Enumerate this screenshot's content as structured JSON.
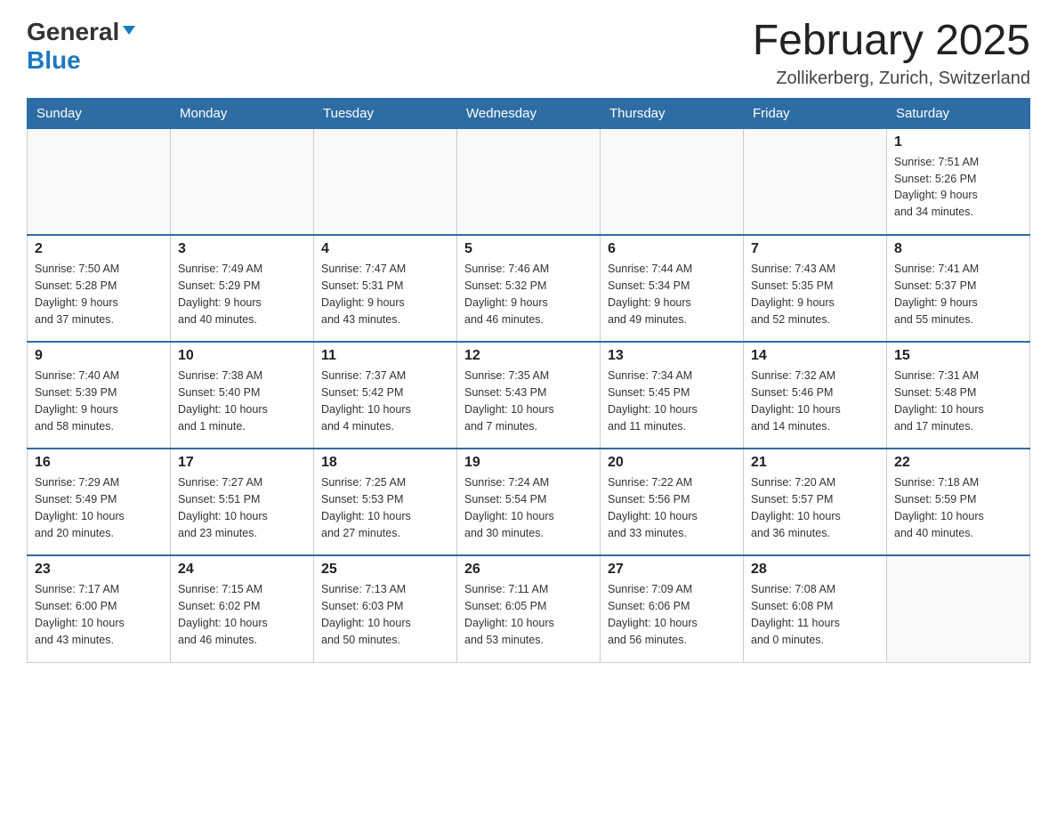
{
  "header": {
    "logo_general": "General",
    "logo_blue": "Blue",
    "month_title": "February 2025",
    "location": "Zollikerberg, Zurich, Switzerland"
  },
  "weekdays": [
    "Sunday",
    "Monday",
    "Tuesday",
    "Wednesday",
    "Thursday",
    "Friday",
    "Saturday"
  ],
  "weeks": [
    [
      {
        "day": "",
        "info": ""
      },
      {
        "day": "",
        "info": ""
      },
      {
        "day": "",
        "info": ""
      },
      {
        "day": "",
        "info": ""
      },
      {
        "day": "",
        "info": ""
      },
      {
        "day": "",
        "info": ""
      },
      {
        "day": "1",
        "info": "Sunrise: 7:51 AM\nSunset: 5:26 PM\nDaylight: 9 hours\nand 34 minutes."
      }
    ],
    [
      {
        "day": "2",
        "info": "Sunrise: 7:50 AM\nSunset: 5:28 PM\nDaylight: 9 hours\nand 37 minutes."
      },
      {
        "day": "3",
        "info": "Sunrise: 7:49 AM\nSunset: 5:29 PM\nDaylight: 9 hours\nand 40 minutes."
      },
      {
        "day": "4",
        "info": "Sunrise: 7:47 AM\nSunset: 5:31 PM\nDaylight: 9 hours\nand 43 minutes."
      },
      {
        "day": "5",
        "info": "Sunrise: 7:46 AM\nSunset: 5:32 PM\nDaylight: 9 hours\nand 46 minutes."
      },
      {
        "day": "6",
        "info": "Sunrise: 7:44 AM\nSunset: 5:34 PM\nDaylight: 9 hours\nand 49 minutes."
      },
      {
        "day": "7",
        "info": "Sunrise: 7:43 AM\nSunset: 5:35 PM\nDaylight: 9 hours\nand 52 minutes."
      },
      {
        "day": "8",
        "info": "Sunrise: 7:41 AM\nSunset: 5:37 PM\nDaylight: 9 hours\nand 55 minutes."
      }
    ],
    [
      {
        "day": "9",
        "info": "Sunrise: 7:40 AM\nSunset: 5:39 PM\nDaylight: 9 hours\nand 58 minutes."
      },
      {
        "day": "10",
        "info": "Sunrise: 7:38 AM\nSunset: 5:40 PM\nDaylight: 10 hours\nand 1 minute."
      },
      {
        "day": "11",
        "info": "Sunrise: 7:37 AM\nSunset: 5:42 PM\nDaylight: 10 hours\nand 4 minutes."
      },
      {
        "day": "12",
        "info": "Sunrise: 7:35 AM\nSunset: 5:43 PM\nDaylight: 10 hours\nand 7 minutes."
      },
      {
        "day": "13",
        "info": "Sunrise: 7:34 AM\nSunset: 5:45 PM\nDaylight: 10 hours\nand 11 minutes."
      },
      {
        "day": "14",
        "info": "Sunrise: 7:32 AM\nSunset: 5:46 PM\nDaylight: 10 hours\nand 14 minutes."
      },
      {
        "day": "15",
        "info": "Sunrise: 7:31 AM\nSunset: 5:48 PM\nDaylight: 10 hours\nand 17 minutes."
      }
    ],
    [
      {
        "day": "16",
        "info": "Sunrise: 7:29 AM\nSunset: 5:49 PM\nDaylight: 10 hours\nand 20 minutes."
      },
      {
        "day": "17",
        "info": "Sunrise: 7:27 AM\nSunset: 5:51 PM\nDaylight: 10 hours\nand 23 minutes."
      },
      {
        "day": "18",
        "info": "Sunrise: 7:25 AM\nSunset: 5:53 PM\nDaylight: 10 hours\nand 27 minutes."
      },
      {
        "day": "19",
        "info": "Sunrise: 7:24 AM\nSunset: 5:54 PM\nDaylight: 10 hours\nand 30 minutes."
      },
      {
        "day": "20",
        "info": "Sunrise: 7:22 AM\nSunset: 5:56 PM\nDaylight: 10 hours\nand 33 minutes."
      },
      {
        "day": "21",
        "info": "Sunrise: 7:20 AM\nSunset: 5:57 PM\nDaylight: 10 hours\nand 36 minutes."
      },
      {
        "day": "22",
        "info": "Sunrise: 7:18 AM\nSunset: 5:59 PM\nDaylight: 10 hours\nand 40 minutes."
      }
    ],
    [
      {
        "day": "23",
        "info": "Sunrise: 7:17 AM\nSunset: 6:00 PM\nDaylight: 10 hours\nand 43 minutes."
      },
      {
        "day": "24",
        "info": "Sunrise: 7:15 AM\nSunset: 6:02 PM\nDaylight: 10 hours\nand 46 minutes."
      },
      {
        "day": "25",
        "info": "Sunrise: 7:13 AM\nSunset: 6:03 PM\nDaylight: 10 hours\nand 50 minutes."
      },
      {
        "day": "26",
        "info": "Sunrise: 7:11 AM\nSunset: 6:05 PM\nDaylight: 10 hours\nand 53 minutes."
      },
      {
        "day": "27",
        "info": "Sunrise: 7:09 AM\nSunset: 6:06 PM\nDaylight: 10 hours\nand 56 minutes."
      },
      {
        "day": "28",
        "info": "Sunrise: 7:08 AM\nSunset: 6:08 PM\nDaylight: 11 hours\nand 0 minutes."
      },
      {
        "day": "",
        "info": ""
      }
    ]
  ]
}
